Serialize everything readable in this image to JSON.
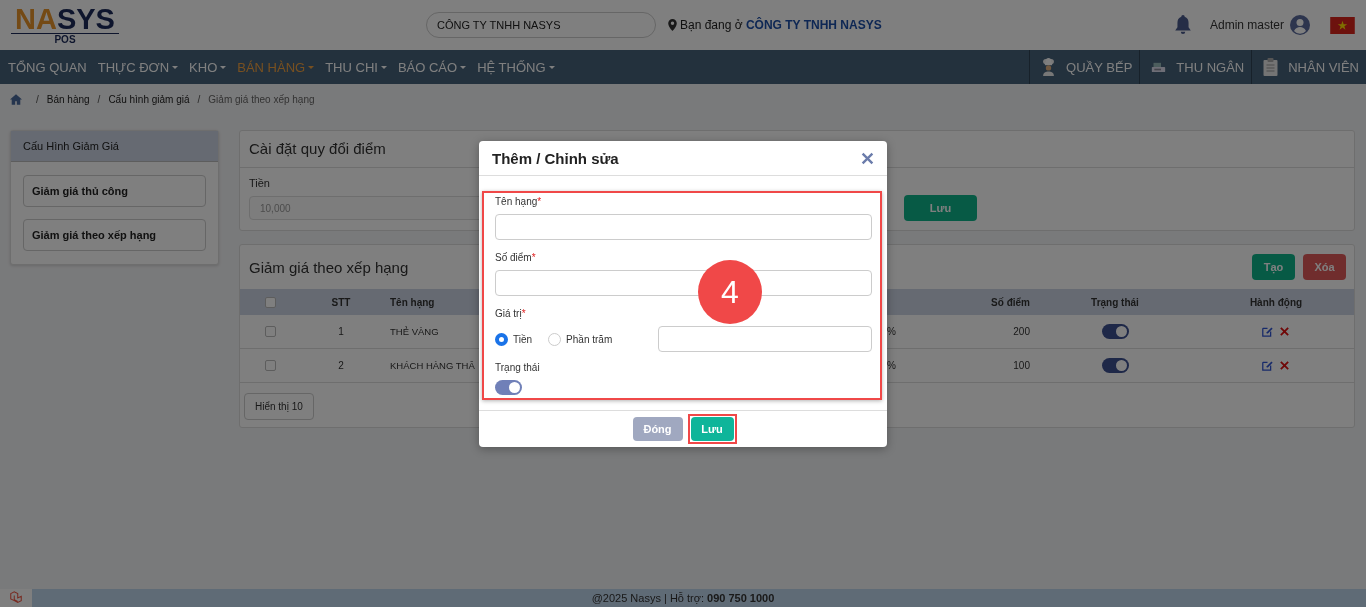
{
  "header": {
    "logo": [
      "NA",
      "SYS"
    ],
    "logo_sub": "POS",
    "company_field": "CÔNG TY TNHH NASYS",
    "location_prefix": "Bạn đang ở",
    "location_company": "CÔNG TY TNHH NASYS",
    "user": "Admin master"
  },
  "nav": {
    "items": [
      {
        "label": "TỔNG QUAN",
        "dropdown": false,
        "selected": false
      },
      {
        "label": "THỰC ĐƠN",
        "dropdown": true,
        "selected": false
      },
      {
        "label": "KHO",
        "dropdown": true,
        "selected": false
      },
      {
        "label": "BÁN HÀNG",
        "dropdown": true,
        "selected": true
      },
      {
        "label": "THU CHI",
        "dropdown": true,
        "selected": false
      },
      {
        "label": "BÁO CÁO",
        "dropdown": true,
        "selected": false
      },
      {
        "label": "HỆ THỐNG",
        "dropdown": true,
        "selected": false
      }
    ],
    "right": [
      {
        "label": "QUẦY BẾP",
        "kind": "chef"
      },
      {
        "label": "THU NGÂN",
        "kind": "cashier"
      },
      {
        "label": "NHÂN VIÊN",
        "kind": "clipboard"
      }
    ]
  },
  "breadcrumb": {
    "separator": "/",
    "items": [
      "Bán hàng",
      "Cấu hình giảm giá",
      "Giảm giá theo xếp hạng"
    ]
  },
  "sidebar": {
    "title": "Cấu Hình Giảm Giá",
    "items": [
      "Giảm giá thủ công",
      "Giảm giá theo xếp hạng"
    ]
  },
  "conversion": {
    "title": "Cài đặt quy đổi điểm",
    "label": "Tiền",
    "value": "10,000",
    "button": "Lưu"
  },
  "ranking": {
    "title": "Giảm giá theo xếp hạng",
    "buttons": [
      {
        "label": "Tạo",
        "kind": "primary"
      },
      {
        "label": "Xóa",
        "kind": "danger"
      }
    ],
    "all_checked": false,
    "columns": [
      "STT",
      "Tên hạng",
      "Số điểm",
      "Trạng thái",
      "Hành động"
    ],
    "rows": [
      {
        "checked": false,
        "stt": "1",
        "name": "THẺ VÀNG",
        "column_4": "%",
        "points": "200",
        "on": true
      },
      {
        "checked": false,
        "stt": "2",
        "name": "KHÁCH HÀNG THÂ",
        "column_4": "%",
        "points": "100",
        "on": true
      }
    ],
    "page_size": "Hiển thị 10"
  },
  "modal": {
    "title": "Thêm / Chỉnh sửa",
    "fields": [
      {
        "label": "Tên hạng",
        "required": true
      },
      {
        "label": "Số điểm",
        "required": true
      }
    ],
    "required_mark": "*",
    "value_label": "Giá trị",
    "value_required": true,
    "options": [
      {
        "label": "Tiền",
        "selected": true
      },
      {
        "label": "Phần trăm",
        "selected": false
      }
    ],
    "status_label": "Trạng thái",
    "status_on": true,
    "buttons": [
      {
        "label": "Đóng",
        "kind": "secondary",
        "highlighted": false
      },
      {
        "label": "Lưu",
        "kind": "primary",
        "highlighted": true
      }
    ],
    "step": "4"
  },
  "footer": {
    "text": "@2025 Nasys | Hỗ trợ: **090 750 1000**"
  }
}
